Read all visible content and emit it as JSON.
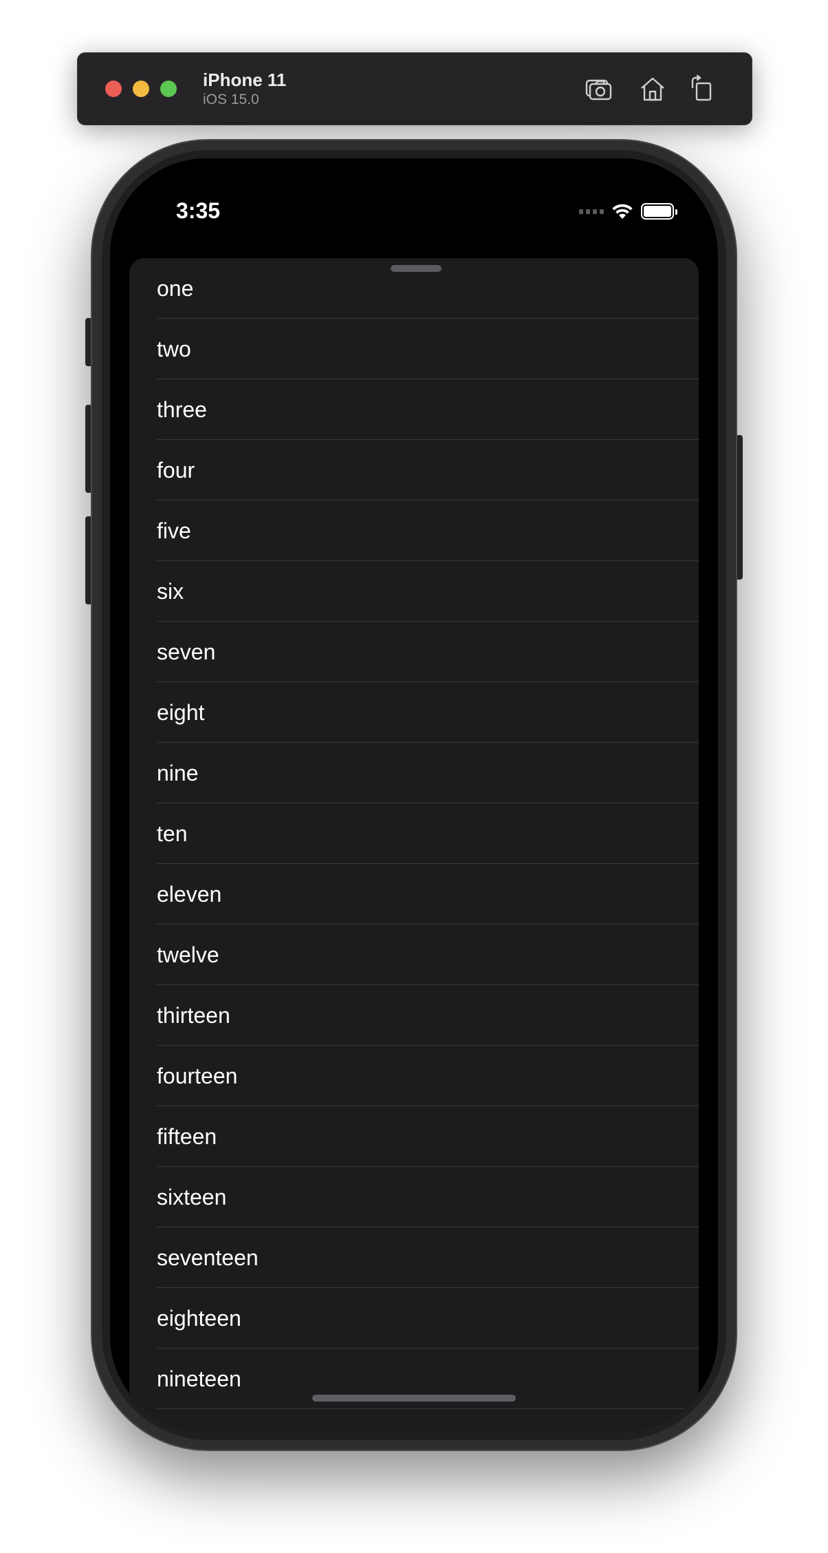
{
  "simulator": {
    "device_name": "iPhone 11",
    "os_version": "iOS 15.0",
    "buttons": {
      "screenshot_icon": "camera-icon",
      "home_icon": "home-icon",
      "rotate_icon": "rotate-icon"
    }
  },
  "status_bar": {
    "time": "3:35"
  },
  "list": {
    "items": [
      "one",
      "two",
      "three",
      "four",
      "five",
      "six",
      "seven",
      "eight",
      "nine",
      "ten",
      "eleven",
      "twelve",
      "thirteen",
      "fourteen",
      "fifteen",
      "sixteen",
      "seventeen",
      "eighteen",
      "nineteen"
    ]
  },
  "colors": {
    "background": "#000000",
    "sheet": "#1c1c1e",
    "separator": "#38383a",
    "text": "#ffffff"
  }
}
